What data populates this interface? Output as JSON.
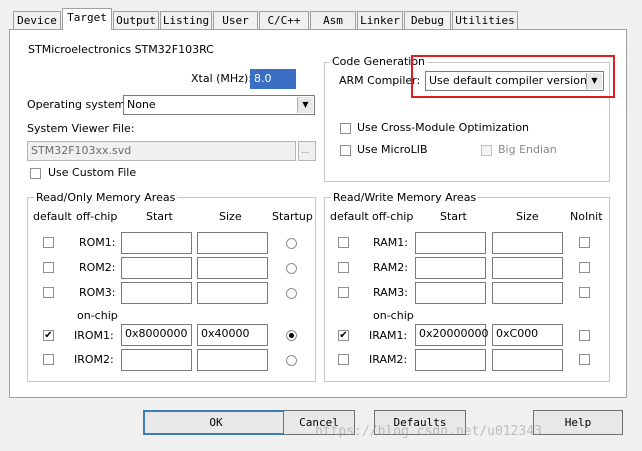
{
  "tabs": [
    "Device",
    "Target",
    "Output",
    "Listing",
    "User",
    "C/C++",
    "Asm",
    "Linker",
    "Debug",
    "Utilities"
  ],
  "active_tab": "Target",
  "device_name": "STMicroelectronics STM32F103RC",
  "xtal": {
    "label": "Xtal (MHz):",
    "value": "8.0"
  },
  "os": {
    "label": "Operating system:",
    "value": "None"
  },
  "svd": {
    "label": "System Viewer File:",
    "value": "STM32F103xx.svd",
    "browse": "..."
  },
  "custom_file": {
    "label": "Use Custom File",
    "checked": false
  },
  "codegen": {
    "title": "Code Generation",
    "compiler_label": "ARM Compiler:",
    "compiler_value": "Use default compiler version",
    "cross_module": "Use Cross-Module Optimization",
    "microlib": "Use MicroLIB",
    "big_endian": "Big Endian",
    "highlight_color": "#e02020"
  },
  "ro_memory": {
    "title": "Read/Only Memory Areas",
    "headers": {
      "default": "default",
      "offchip": "off-chip",
      "start": "Start",
      "size": "Size",
      "startup": "Startup"
    },
    "onchip_label": "on-chip",
    "rows": [
      {
        "name": "ROM1:",
        "default": false,
        "start": "",
        "size": "",
        "startup": false
      },
      {
        "name": "ROM2:",
        "default": false,
        "start": "",
        "size": "",
        "startup": false
      },
      {
        "name": "ROM3:",
        "default": false,
        "start": "",
        "size": "",
        "startup": false
      },
      {
        "name": "IROM1:",
        "default": true,
        "start": "0x8000000",
        "size": "0x40000",
        "startup": true
      },
      {
        "name": "IROM2:",
        "default": false,
        "start": "",
        "size": "",
        "startup": false
      }
    ]
  },
  "rw_memory": {
    "title": "Read/Write Memory Areas",
    "headers": {
      "default": "default",
      "offchip": "off-chip",
      "start": "Start",
      "size": "Size",
      "noinit": "NoInit"
    },
    "onchip_label": "on-chip",
    "rows": [
      {
        "name": "RAM1:",
        "default": false,
        "start": "",
        "size": "",
        "noinit": false
      },
      {
        "name": "RAM2:",
        "default": false,
        "start": "",
        "size": "",
        "noinit": false
      },
      {
        "name": "RAM3:",
        "default": false,
        "start": "",
        "size": "",
        "noinit": false
      },
      {
        "name": "IRAM1:",
        "default": true,
        "start": "0x20000000",
        "size": "0xC000",
        "noinit": false
      },
      {
        "name": "IRAM2:",
        "default": false,
        "start": "",
        "size": "",
        "noinit": false
      }
    ]
  },
  "buttons": {
    "ok": "OK",
    "cancel": "Cancel",
    "defaults": "Defaults",
    "help": "Help"
  },
  "watermark": "https://blog.csdn.net/u012343"
}
